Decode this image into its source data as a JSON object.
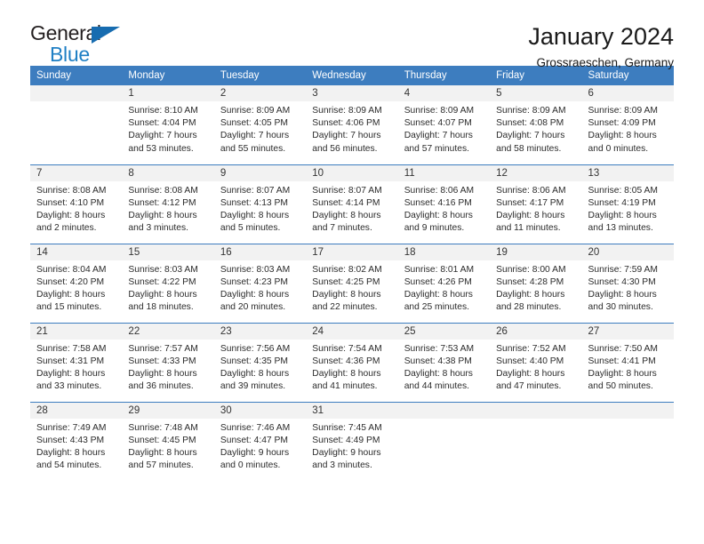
{
  "brand": {
    "name_part1": "General",
    "name_part2": "Blue",
    "accent_color": "#1f7fc4",
    "triangle_color": "#176cb0"
  },
  "header": {
    "title": "January 2024",
    "subtitle": "Grossraeschen, Germany"
  },
  "theme": {
    "header_row_bg": "#3d7dbf",
    "day_number_bg": "#f2f2f2",
    "cell_bg": "#ffffff",
    "text_color": "#2b2b2b"
  },
  "weekday_headers": [
    "Sunday",
    "Monday",
    "Tuesday",
    "Wednesday",
    "Thursday",
    "Friday",
    "Saturday"
  ],
  "weeks": [
    [
      {
        "day": "",
        "sunrise": "",
        "sunset": "",
        "daylight_line1": "",
        "daylight_line2": "",
        "empty": true
      },
      {
        "day": "1",
        "sunrise": "Sunrise: 8:10 AM",
        "sunset": "Sunset: 4:04 PM",
        "daylight_line1": "Daylight: 7 hours",
        "daylight_line2": "and 53 minutes."
      },
      {
        "day": "2",
        "sunrise": "Sunrise: 8:09 AM",
        "sunset": "Sunset: 4:05 PM",
        "daylight_line1": "Daylight: 7 hours",
        "daylight_line2": "and 55 minutes."
      },
      {
        "day": "3",
        "sunrise": "Sunrise: 8:09 AM",
        "sunset": "Sunset: 4:06 PM",
        "daylight_line1": "Daylight: 7 hours",
        "daylight_line2": "and 56 minutes."
      },
      {
        "day": "4",
        "sunrise": "Sunrise: 8:09 AM",
        "sunset": "Sunset: 4:07 PM",
        "daylight_line1": "Daylight: 7 hours",
        "daylight_line2": "and 57 minutes."
      },
      {
        "day": "5",
        "sunrise": "Sunrise: 8:09 AM",
        "sunset": "Sunset: 4:08 PM",
        "daylight_line1": "Daylight: 7 hours",
        "daylight_line2": "and 58 minutes."
      },
      {
        "day": "6",
        "sunrise": "Sunrise: 8:09 AM",
        "sunset": "Sunset: 4:09 PM",
        "daylight_line1": "Daylight: 8 hours",
        "daylight_line2": "and 0 minutes."
      }
    ],
    [
      {
        "day": "7",
        "sunrise": "Sunrise: 8:08 AM",
        "sunset": "Sunset: 4:10 PM",
        "daylight_line1": "Daylight: 8 hours",
        "daylight_line2": "and 2 minutes."
      },
      {
        "day": "8",
        "sunrise": "Sunrise: 8:08 AM",
        "sunset": "Sunset: 4:12 PM",
        "daylight_line1": "Daylight: 8 hours",
        "daylight_line2": "and 3 minutes."
      },
      {
        "day": "9",
        "sunrise": "Sunrise: 8:07 AM",
        "sunset": "Sunset: 4:13 PM",
        "daylight_line1": "Daylight: 8 hours",
        "daylight_line2": "and 5 minutes."
      },
      {
        "day": "10",
        "sunrise": "Sunrise: 8:07 AM",
        "sunset": "Sunset: 4:14 PM",
        "daylight_line1": "Daylight: 8 hours",
        "daylight_line2": "and 7 minutes."
      },
      {
        "day": "11",
        "sunrise": "Sunrise: 8:06 AM",
        "sunset": "Sunset: 4:16 PM",
        "daylight_line1": "Daylight: 8 hours",
        "daylight_line2": "and 9 minutes."
      },
      {
        "day": "12",
        "sunrise": "Sunrise: 8:06 AM",
        "sunset": "Sunset: 4:17 PM",
        "daylight_line1": "Daylight: 8 hours",
        "daylight_line2": "and 11 minutes."
      },
      {
        "day": "13",
        "sunrise": "Sunrise: 8:05 AM",
        "sunset": "Sunset: 4:19 PM",
        "daylight_line1": "Daylight: 8 hours",
        "daylight_line2": "and 13 minutes."
      }
    ],
    [
      {
        "day": "14",
        "sunrise": "Sunrise: 8:04 AM",
        "sunset": "Sunset: 4:20 PM",
        "daylight_line1": "Daylight: 8 hours",
        "daylight_line2": "and 15 minutes."
      },
      {
        "day": "15",
        "sunrise": "Sunrise: 8:03 AM",
        "sunset": "Sunset: 4:22 PM",
        "daylight_line1": "Daylight: 8 hours",
        "daylight_line2": "and 18 minutes."
      },
      {
        "day": "16",
        "sunrise": "Sunrise: 8:03 AM",
        "sunset": "Sunset: 4:23 PM",
        "daylight_line1": "Daylight: 8 hours",
        "daylight_line2": "and 20 minutes."
      },
      {
        "day": "17",
        "sunrise": "Sunrise: 8:02 AM",
        "sunset": "Sunset: 4:25 PM",
        "daylight_line1": "Daylight: 8 hours",
        "daylight_line2": "and 22 minutes."
      },
      {
        "day": "18",
        "sunrise": "Sunrise: 8:01 AM",
        "sunset": "Sunset: 4:26 PM",
        "daylight_line1": "Daylight: 8 hours",
        "daylight_line2": "and 25 minutes."
      },
      {
        "day": "19",
        "sunrise": "Sunrise: 8:00 AM",
        "sunset": "Sunset: 4:28 PM",
        "daylight_line1": "Daylight: 8 hours",
        "daylight_line2": "and 28 minutes."
      },
      {
        "day": "20",
        "sunrise": "Sunrise: 7:59 AM",
        "sunset": "Sunset: 4:30 PM",
        "daylight_line1": "Daylight: 8 hours",
        "daylight_line2": "and 30 minutes."
      }
    ],
    [
      {
        "day": "21",
        "sunrise": "Sunrise: 7:58 AM",
        "sunset": "Sunset: 4:31 PM",
        "daylight_line1": "Daylight: 8 hours",
        "daylight_line2": "and 33 minutes."
      },
      {
        "day": "22",
        "sunrise": "Sunrise: 7:57 AM",
        "sunset": "Sunset: 4:33 PM",
        "daylight_line1": "Daylight: 8 hours",
        "daylight_line2": "and 36 minutes."
      },
      {
        "day": "23",
        "sunrise": "Sunrise: 7:56 AM",
        "sunset": "Sunset: 4:35 PM",
        "daylight_line1": "Daylight: 8 hours",
        "daylight_line2": "and 39 minutes."
      },
      {
        "day": "24",
        "sunrise": "Sunrise: 7:54 AM",
        "sunset": "Sunset: 4:36 PM",
        "daylight_line1": "Daylight: 8 hours",
        "daylight_line2": "and 41 minutes."
      },
      {
        "day": "25",
        "sunrise": "Sunrise: 7:53 AM",
        "sunset": "Sunset: 4:38 PM",
        "daylight_line1": "Daylight: 8 hours",
        "daylight_line2": "and 44 minutes."
      },
      {
        "day": "26",
        "sunrise": "Sunrise: 7:52 AM",
        "sunset": "Sunset: 4:40 PM",
        "daylight_line1": "Daylight: 8 hours",
        "daylight_line2": "and 47 minutes."
      },
      {
        "day": "27",
        "sunrise": "Sunrise: 7:50 AM",
        "sunset": "Sunset: 4:41 PM",
        "daylight_line1": "Daylight: 8 hours",
        "daylight_line2": "and 50 minutes."
      }
    ],
    [
      {
        "day": "28",
        "sunrise": "Sunrise: 7:49 AM",
        "sunset": "Sunset: 4:43 PM",
        "daylight_line1": "Daylight: 8 hours",
        "daylight_line2": "and 54 minutes."
      },
      {
        "day": "29",
        "sunrise": "Sunrise: 7:48 AM",
        "sunset": "Sunset: 4:45 PM",
        "daylight_line1": "Daylight: 8 hours",
        "daylight_line2": "and 57 minutes."
      },
      {
        "day": "30",
        "sunrise": "Sunrise: 7:46 AM",
        "sunset": "Sunset: 4:47 PM",
        "daylight_line1": "Daylight: 9 hours",
        "daylight_line2": "and 0 minutes."
      },
      {
        "day": "31",
        "sunrise": "Sunrise: 7:45 AM",
        "sunset": "Sunset: 4:49 PM",
        "daylight_line1": "Daylight: 9 hours",
        "daylight_line2": "and 3 minutes."
      },
      {
        "day": "",
        "sunrise": "",
        "sunset": "",
        "daylight_line1": "",
        "daylight_line2": "",
        "empty": true,
        "nofill": true
      },
      {
        "day": "",
        "sunrise": "",
        "sunset": "",
        "daylight_line1": "",
        "daylight_line2": "",
        "empty": true,
        "nofill": true
      },
      {
        "day": "",
        "sunrise": "",
        "sunset": "",
        "daylight_line1": "",
        "daylight_line2": "",
        "empty": true,
        "nofill": true
      }
    ]
  ]
}
